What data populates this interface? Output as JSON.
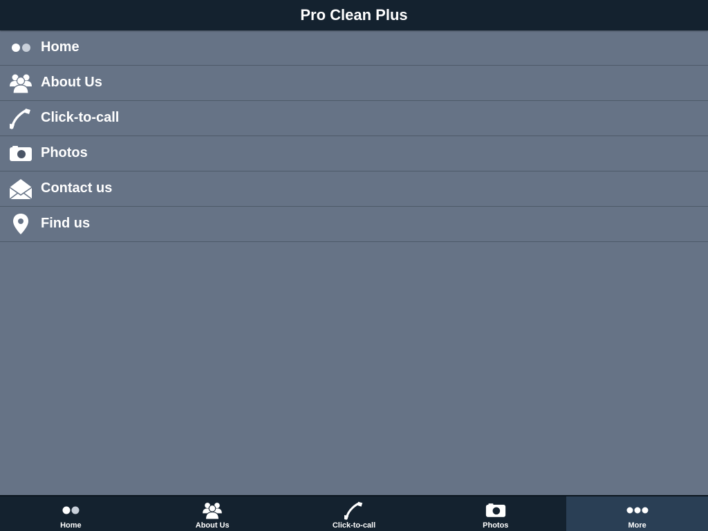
{
  "header": {
    "title": "Pro Clean Plus"
  },
  "menu": {
    "items": [
      {
        "label": "Home",
        "icon": "dots-icon"
      },
      {
        "label": "About Us",
        "icon": "users-icon"
      },
      {
        "label": "Click-to-call",
        "icon": "phone-icon"
      },
      {
        "label": "Photos",
        "icon": "camera-icon"
      },
      {
        "label": "Contact us",
        "icon": "envelope-icon"
      },
      {
        "label": "Find us",
        "icon": "map-pin-icon"
      }
    ]
  },
  "tabbar": {
    "active": "More",
    "items": [
      {
        "label": "Home",
        "icon": "dots-icon"
      },
      {
        "label": "About Us",
        "icon": "users-icon"
      },
      {
        "label": "Click-to-call",
        "icon": "phone-icon"
      },
      {
        "label": "Photos",
        "icon": "camera-icon"
      },
      {
        "label": "More",
        "icon": "more-icon"
      }
    ]
  },
  "colors": {
    "background": "#667386",
    "header": "#14222f",
    "tabbar": "#14222f",
    "tab_active": "#2a3f55",
    "text": "#ffffff"
  }
}
